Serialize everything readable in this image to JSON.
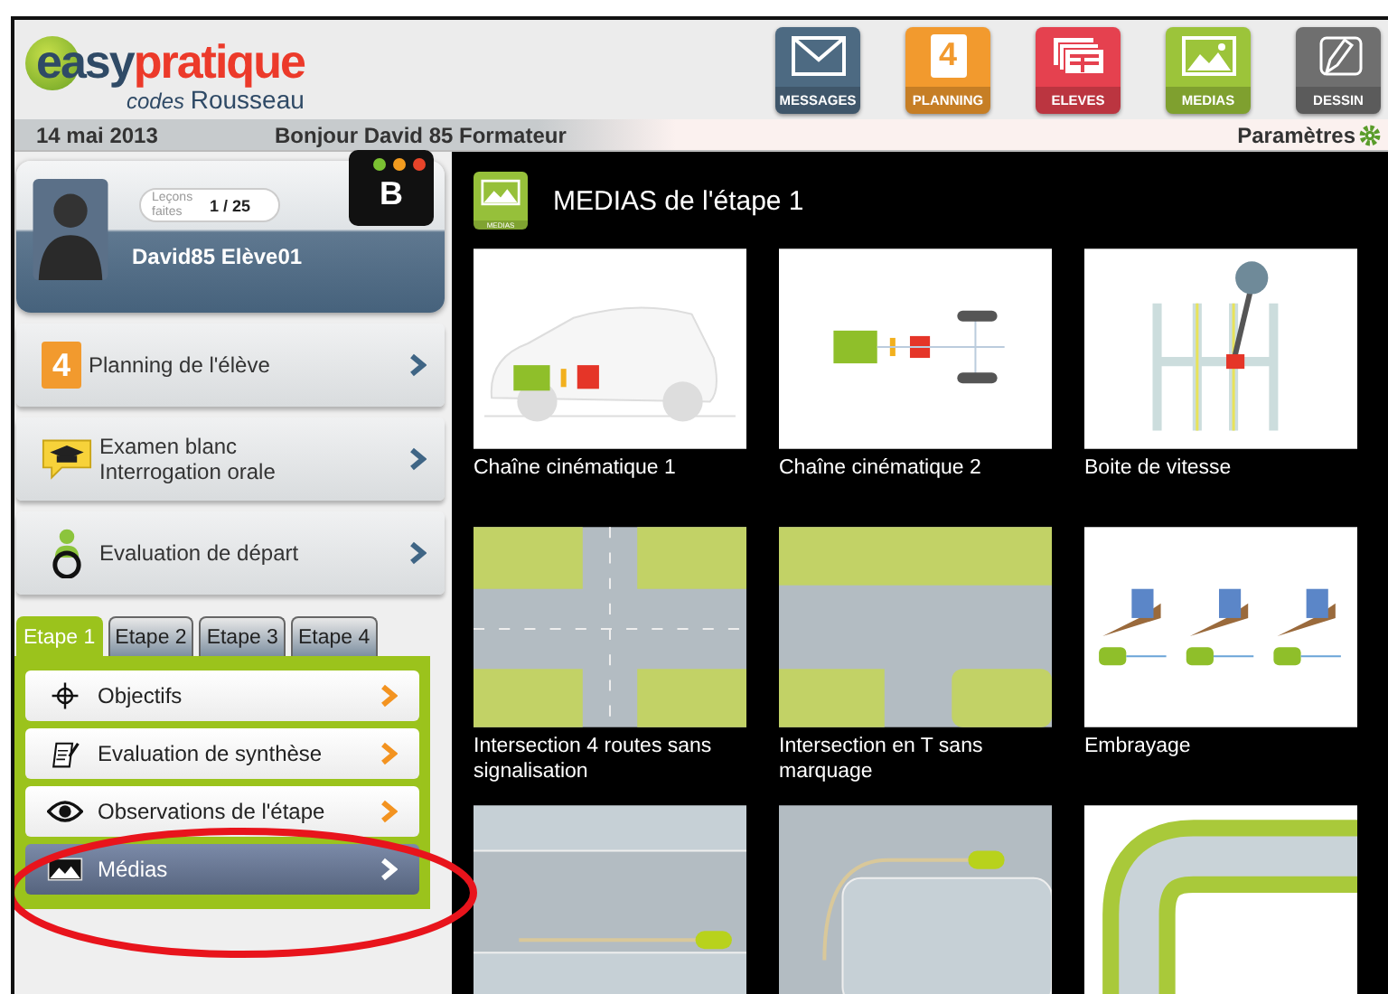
{
  "header": {
    "logo": {
      "word_1": "easy",
      "word_2": "pratique",
      "sub_1": "codes",
      "sub_2": "Rousseau"
    },
    "nav": [
      {
        "kind": "messages",
        "label": "MESSAGES",
        "color": "#4d6a82"
      },
      {
        "kind": "planning",
        "label": "PLANNING",
        "color": "#f29a2e",
        "icon_text": "4"
      },
      {
        "kind": "students",
        "label": "ELEVES",
        "color": "#e5414f"
      },
      {
        "kind": "medias",
        "label": "MEDIAS",
        "color": "#9cc43a"
      },
      {
        "kind": "drawing",
        "label": "DESSIN",
        "color": "#6f6f6f"
      }
    ]
  },
  "info_bar": {
    "date": "14 mai 2013",
    "greeting": "Bonjour David 85 Formateur",
    "settings": "Paramètres"
  },
  "profile": {
    "lessons_label": "Leçons faites",
    "lessons_count": "1 / 25",
    "name": "David85 Elève01",
    "badge": "B"
  },
  "menu": [
    {
      "kind": "planning",
      "icon_text": "4",
      "lines": [
        "Planning de l'élève"
      ]
    },
    {
      "kind": "exam",
      "lines": [
        "Examen blanc",
        "Interrogation orale"
      ]
    },
    {
      "kind": "evaluation",
      "lines": [
        "Evaluation de départ"
      ]
    }
  ],
  "tabs": [
    {
      "label": "Etape 1",
      "selected": true
    },
    {
      "label": "Etape 2",
      "selected": false
    },
    {
      "label": "Etape 3",
      "selected": false
    },
    {
      "label": "Etape 4",
      "selected": false
    }
  ],
  "stage_items": [
    {
      "kind": "target",
      "label": "Objectifs",
      "selected": false
    },
    {
      "kind": "clipboard",
      "label": "Evaluation de synthèse",
      "selected": false
    },
    {
      "kind": "eye",
      "label": "Observations de l'étape",
      "selected": false
    },
    {
      "kind": "picture",
      "label": "Médias",
      "selected": true
    }
  ],
  "medias": {
    "title": "MEDIAS de l'étape 1",
    "icon_label": "MEDIAS",
    "items": [
      {
        "kind": "car",
        "caption": "Chaîne cinématique 1"
      },
      {
        "kind": "chain",
        "caption": "Chaîne cinématique 2"
      },
      {
        "kind": "gearbox",
        "caption": "Boite de vitesse"
      },
      {
        "kind": "cross",
        "caption": "Intersection 4 routes sans signalisation"
      },
      {
        "kind": "tjunction",
        "caption": "Intersection en T sans marquage"
      },
      {
        "kind": "clutch",
        "caption": "Embrayage"
      },
      {
        "kind": "straight"
      },
      {
        "kind": "turn"
      },
      {
        "kind": "curve"
      }
    ]
  }
}
